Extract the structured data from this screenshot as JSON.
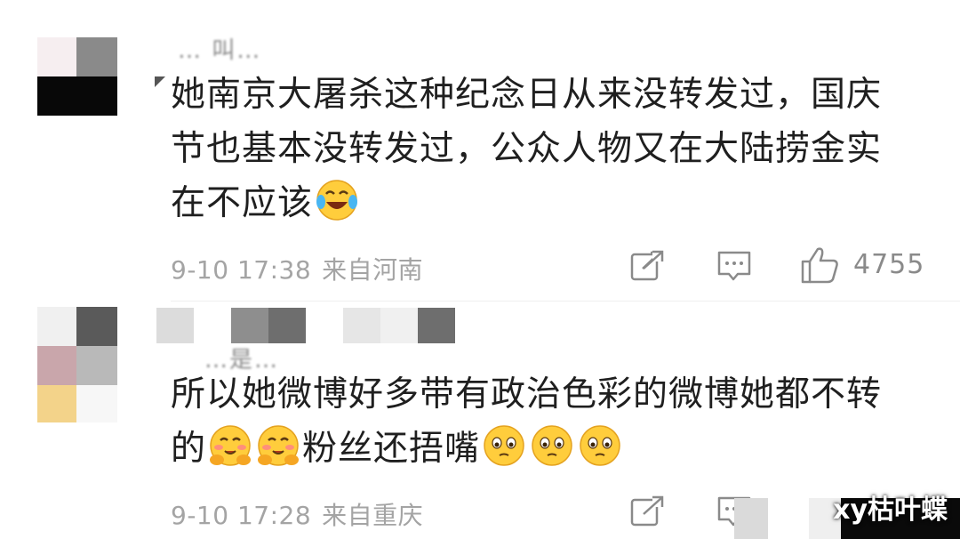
{
  "comments": [
    {
      "text": "她南京大屠杀这种纪念日从来没转发过，国庆\n节也基本没转发过，公众人物又在大陆捞金实\n在不应该",
      "emoji_after": [
        "laugh-cry-emoji"
      ],
      "date": "9-10 17:38",
      "location": "来自河南",
      "like_count": "4755",
      "name_partial": "… 叫…"
    },
    {
      "text_part1": "所以她微博好多带有政治色彩的微博她都不转\n的",
      "emoji_mid": [
        "blush-hands-emoji",
        "blush-hands-emoji"
      ],
      "text_part2": "粉丝还捂嘴",
      "emoji_after": [
        "sad-face-emoji",
        "sad-face-emoji",
        "sad-face-emoji"
      ],
      "date": "9-10 17:28",
      "location": "来自重庆",
      "name_partial": "…是…"
    }
  ],
  "watermark": "xy枯叶蝶",
  "colors": {
    "meta": "#a4a4a4",
    "text": "#1f1f1f"
  }
}
